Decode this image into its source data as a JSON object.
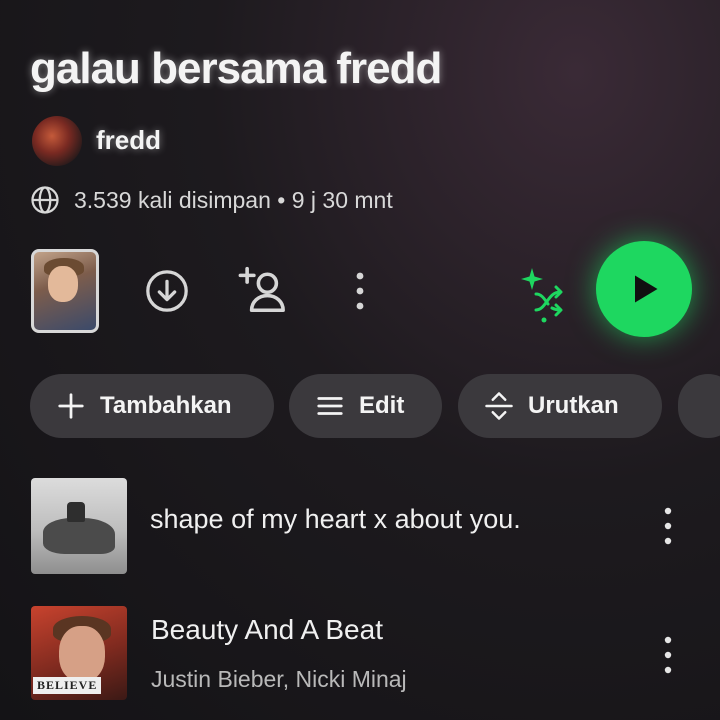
{
  "playlist": {
    "title": "galau bersama fredd",
    "owner": "fredd",
    "stats": "3.539 kali disimpan • 9 j 30 mnt"
  },
  "actions": {
    "chips": [
      {
        "label": "Tambahkan",
        "icon": "plus-icon"
      },
      {
        "label": "Edit",
        "icon": "lines-icon"
      },
      {
        "label": "Urutkan",
        "icon": "sort-icon"
      }
    ],
    "icons": [
      "download-icon",
      "add-user-icon",
      "more-vertical-icon",
      "smart-shuffle-icon",
      "play-icon"
    ]
  },
  "tracks": [
    {
      "title": "shape of my heart x about you.",
      "artist": ""
    },
    {
      "title": "Beauty And A Beat",
      "artist": "Justin Bieber, Nicki Minaj",
      "album_label": "BELIEVE"
    }
  ],
  "colors": {
    "accent": "#1ed760",
    "chip_bg": "#3b393d",
    "background": "#1d1a1e"
  }
}
